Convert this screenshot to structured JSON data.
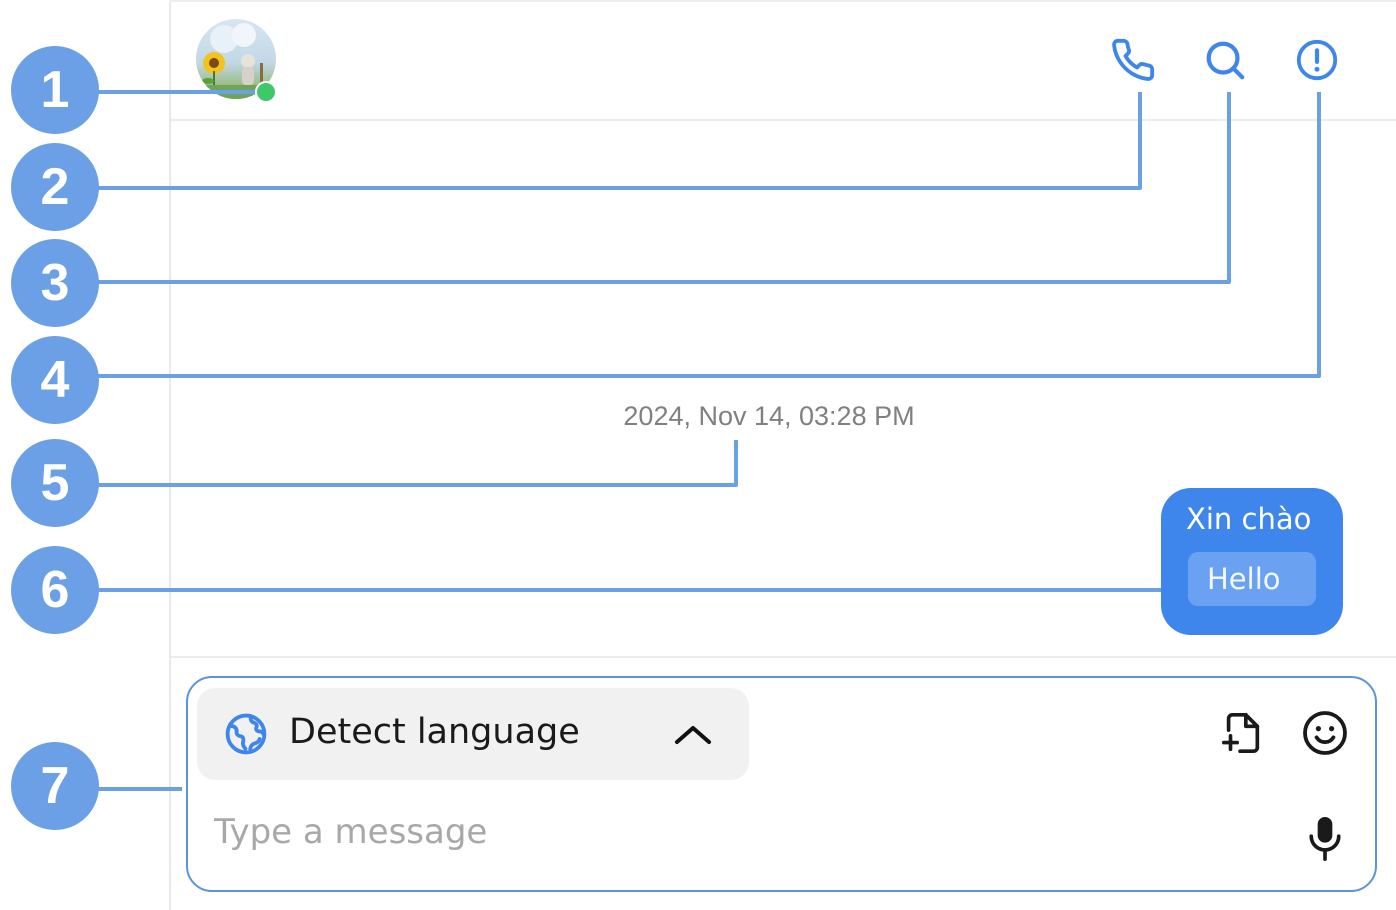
{
  "chat": {
    "timestamp": "2024, Nov 14, 03:28 PM",
    "message": {
      "text": "Xin chào",
      "translation": "Hello"
    }
  },
  "header": {
    "status": "online",
    "icons": [
      "phone-icon",
      "search-icon",
      "info-icon"
    ]
  },
  "composer": {
    "language_label": "Detect language",
    "placeholder": "Type a message",
    "icons": [
      "globe-icon",
      "chevron-up-icon",
      "attach-file-icon",
      "emoji-icon",
      "microphone-icon"
    ]
  },
  "callouts": [
    "1",
    "2",
    "3",
    "4",
    "5",
    "6",
    "7"
  ],
  "colors": {
    "accent": "#3f86ec",
    "callout": "#6ca0e6",
    "online": "#3ec86a",
    "timestamp": "#808080"
  }
}
